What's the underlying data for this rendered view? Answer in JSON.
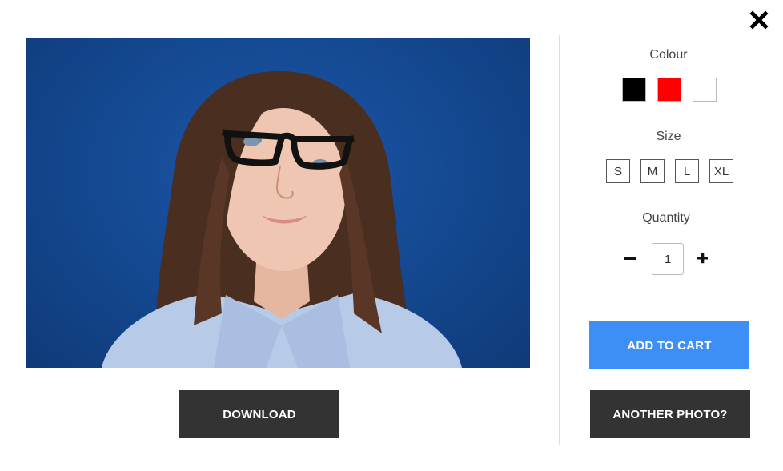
{
  "close": {
    "icon": "close-icon"
  },
  "options": {
    "colour_label": "Colour",
    "colours": [
      {
        "name": "black",
        "hex": "#000000"
      },
      {
        "name": "red",
        "hex": "#ff0000"
      },
      {
        "name": "white",
        "hex": "#ffffff"
      }
    ],
    "size_label": "Size",
    "sizes": [
      "S",
      "M",
      "L",
      "XL"
    ],
    "quantity_label": "Quantity",
    "quantity_value": "1"
  },
  "actions": {
    "add_to_cart": "ADD TO CART",
    "another_photo": "ANOTHER PHOTO?",
    "download": "DOWNLOAD"
  },
  "colors": {
    "primary_button": "#3d8ef5",
    "dark_button": "#333333"
  }
}
